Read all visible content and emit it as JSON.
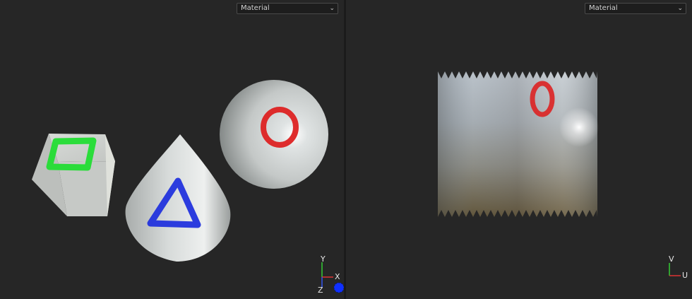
{
  "viewports": {
    "left": {
      "mode": "Material"
    },
    "right": {
      "mode": "Material"
    }
  },
  "gizmo3d": {
    "y": "Y",
    "x": "X",
    "z": "Z"
  },
  "gizmo2d": {
    "v": "V",
    "u": "U"
  },
  "shapes": [
    {
      "name": "cube",
      "marker": "square",
      "marker_color": "#22dd33"
    },
    {
      "name": "cone",
      "marker": "triangle",
      "marker_color": "#2233dd"
    },
    {
      "name": "sphere",
      "marker": "circle",
      "marker_color": "#dd2222"
    }
  ],
  "uv_marker_color": "#dd2222"
}
